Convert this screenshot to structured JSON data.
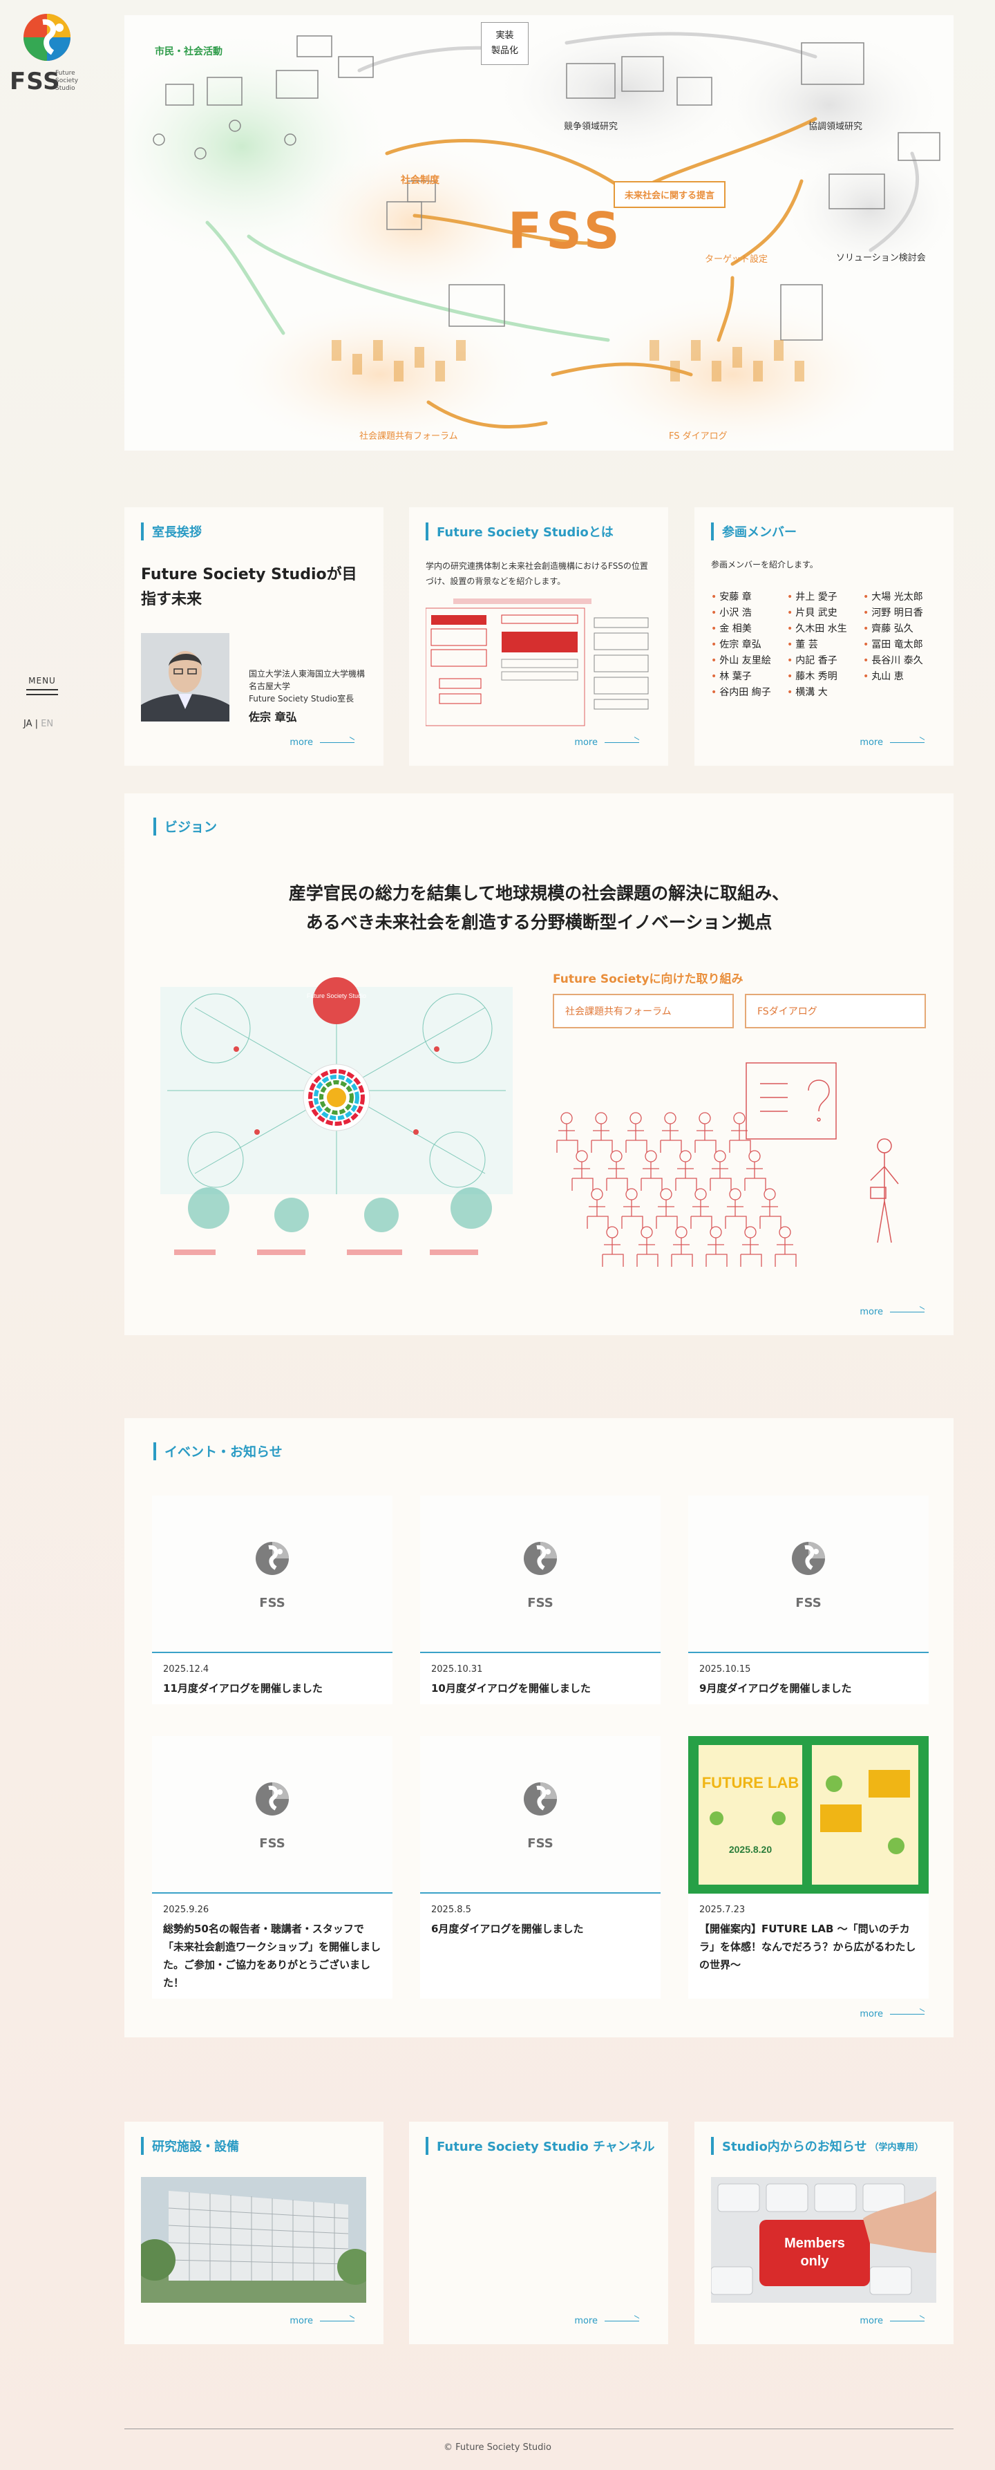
{
  "brand": {
    "logo_text": "FSS",
    "logo_sub": "Future Society Studio"
  },
  "nav": {
    "menu_label": "MENU",
    "lang_ja": "JA",
    "lang_sep": "|",
    "lang_en": "EN"
  },
  "hero": {
    "center": "FSS",
    "labels": {
      "citizen": "市民・社会活動",
      "social_impl": "社会制度",
      "proposal": "未来社会に関する提言",
      "competitive": "競争領域研究",
      "cooperative": "協調領域研究",
      "solution": "ソリューション検討会",
      "target": "ターゲット設定",
      "forum": "社会課題共有フォーラム",
      "dialogue": "FS ダイアログ",
      "impl1": "実装",
      "impl2": "製品化"
    }
  },
  "greeting": {
    "heading": "室長挨拶",
    "title": "Future Society Studioが目指す未来",
    "aff1": "国立大学法人東海国立大学機構",
    "aff2": "名古屋大学",
    "aff3": "Future Society Studio室長",
    "name": "佐宗 章弘",
    "more": "more"
  },
  "about": {
    "heading": "Future Society Studioとは",
    "text": "学内の研究連携体制と未来社会創造機構におけるFSSの位置づけ、設置の背景などを紹介します。",
    "more": "more"
  },
  "members": {
    "heading": "参画メンバー",
    "intro": "参画メンバーを紹介します。",
    "list": [
      "安藤 章",
      "井上 愛子",
      "大場 光太郎",
      "小沢 浩",
      "片貝 武史",
      "河野 明日香",
      "金 相美",
      "久木田 水生",
      "齊藤 弘久",
      "佐宗 章弘",
      "董 芸",
      "冨田 竜太郎",
      "外山 友里絵",
      "内記 香子",
      "長谷川 泰久",
      "林 葉子",
      "藤木 秀明",
      "丸山 恵",
      "谷内田 絢子",
      "横溝 大"
    ],
    "more": "more"
  },
  "vision": {
    "heading": "ビジョン",
    "line1": "産学官民の総力を結集して地球規模の社会課題の解決に取組み、",
    "line2": "あるべき未来社会を創造する分野横断型イノベーション拠点",
    "fig_center": "Future Society Studio",
    "fs_title": "Future Societyに向けた取り組み",
    "btn_forum": "社会課題共有フォーラム",
    "btn_dialogue": "FSダイアログ",
    "more": "more"
  },
  "events": {
    "heading": "イベント・お知らせ",
    "items": [
      {
        "date": "2025.12.4",
        "title": "11月度ダイアログを開催しました"
      },
      {
        "date": "2025.10.31",
        "title": "10月度ダイアログを開催しました"
      },
      {
        "date": "2025.10.15",
        "title": "9月度ダイアログを開催しました"
      },
      {
        "date": "2025.9.26",
        "title": "総勢約50名の報告者・聴講者・スタッフで「未来社会創造ワークショップ」を開催しました。ご参加・ご協力をありがとうございました！"
      },
      {
        "date": "2025.8.5",
        "title": "6月度ダイアログを開催しました"
      },
      {
        "date": "2025.7.23",
        "title": "【開催案内】FUTURE LAB 〜「問いのチカラ」を体感！なんでだろう？から広がるわたしの世界〜"
      }
    ],
    "thumb_logo": "FSS",
    "poster_text": "FUTURE LAB",
    "poster_date": "2025.8.20",
    "more": "more"
  },
  "facilities": {
    "heading": "研究施設・設備",
    "more": "more"
  },
  "channel": {
    "heading": "Future Society Studio チャンネル",
    "more": "more"
  },
  "news": {
    "heading": "Studio内からのお知らせ",
    "heading_small": "（学内専用）",
    "key_text1": "Members",
    "key_text2": "only",
    "more": "more"
  },
  "footer": {
    "copyright": "© Future Society Studio"
  },
  "colors": {
    "accent": "#2a9bc4",
    "orange": "#e98e3b",
    "member_bullet": "#e0693c"
  }
}
